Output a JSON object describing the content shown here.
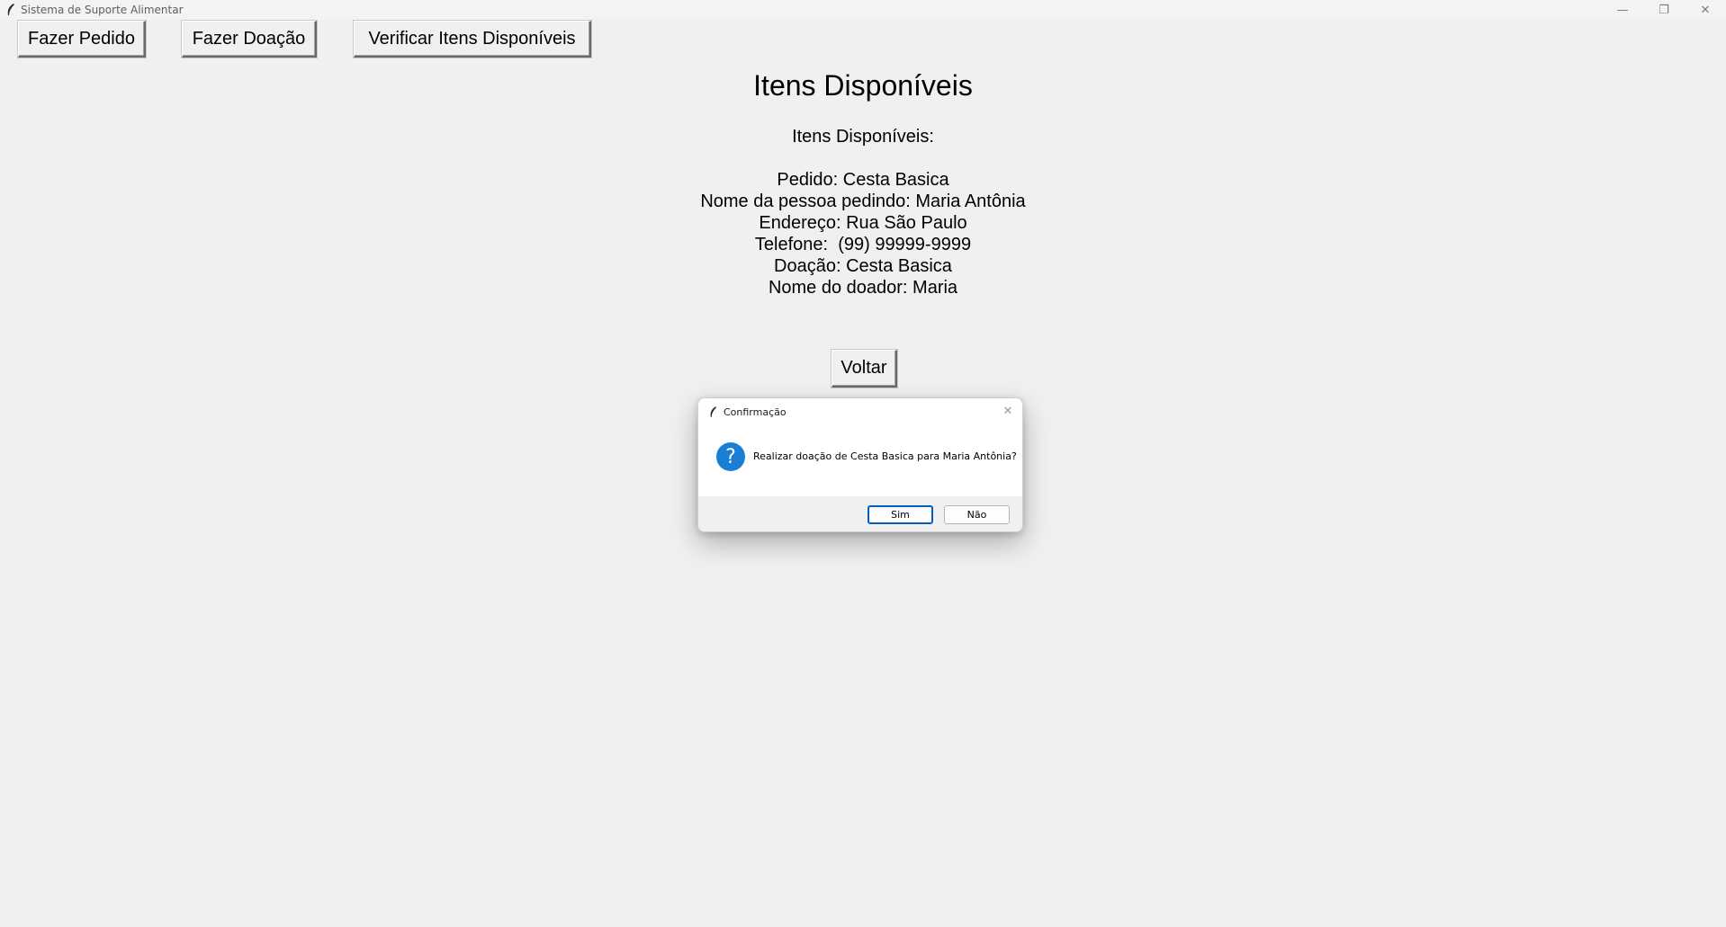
{
  "window": {
    "title": "Sistema de Suporte Alimentar",
    "controls": {
      "minimize": "—",
      "restore": "❐",
      "close": "✕"
    }
  },
  "toolbar": {
    "pedido_label": "Fazer Pedido",
    "doacao_label": "Fazer Doação",
    "verificar_label": "Verificar Itens Disponíveis"
  },
  "main": {
    "heading": "Itens Disponíveis",
    "lines": [
      "Itens Disponíveis:",
      "",
      "Pedido: Cesta Basica",
      "Nome da pessoa pedindo: Maria Antônia",
      "Endereço: Rua São Paulo",
      "Telefone:  (99) 99999-9999",
      "Doação: Cesta Basica",
      "Nome do doador: Maria"
    ],
    "back_label": "Voltar"
  },
  "dialog": {
    "title": "Confirmação",
    "close_glyph": "✕",
    "icon_glyph": "?",
    "message": "Realizar doação de Cesta Basica para Maria Antônia?",
    "yes_label": "Sim",
    "no_label": "Não"
  },
  "colors": {
    "background": "#f0f0f0",
    "dialog_icon": "#1a7fd4",
    "default_button_border": "#0060c0"
  }
}
